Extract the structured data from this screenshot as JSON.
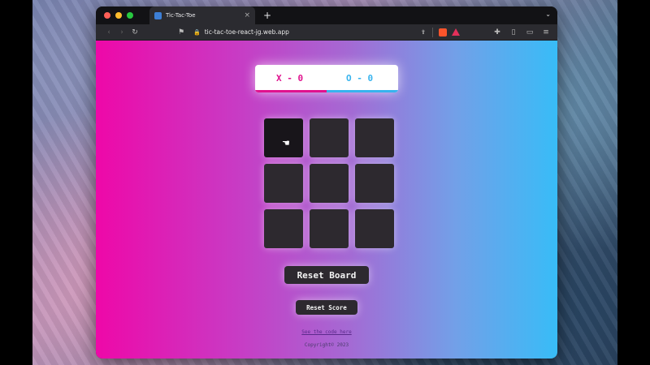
{
  "browser": {
    "tab_title": "Tic-Tac-Toe",
    "tab_close": "×",
    "new_tab": "+",
    "tab_menu": "⌄",
    "url": "tic-tac-toe-react-jg.web.app",
    "icons": {
      "back": "‹",
      "forward": "›",
      "reload": "↻",
      "bookmark": "⚑",
      "lock": "🔒",
      "share": "⇪",
      "extensions": "✚",
      "sidebar": "▯",
      "wallet": "▭",
      "menu": "≡"
    }
  },
  "game": {
    "score_x": "X - 0",
    "score_o": "O - 0",
    "active_player": "X",
    "cells": [
      "",
      "",
      "",
      "",
      "",
      "",
      "",
      "",
      ""
    ],
    "cursor": "☚"
  },
  "buttons": {
    "reset_board": "Reset Board",
    "reset_score": "Reset Score"
  },
  "footer": {
    "code_link": "See the code here",
    "copyright": "Copyright© 2023"
  },
  "colors": {
    "player_x": "#e0128e",
    "player_o": "#37b3ee",
    "cell": "#2d292f",
    "gradient_start": "#ee08a8",
    "gradient_end": "#38bcf7"
  }
}
